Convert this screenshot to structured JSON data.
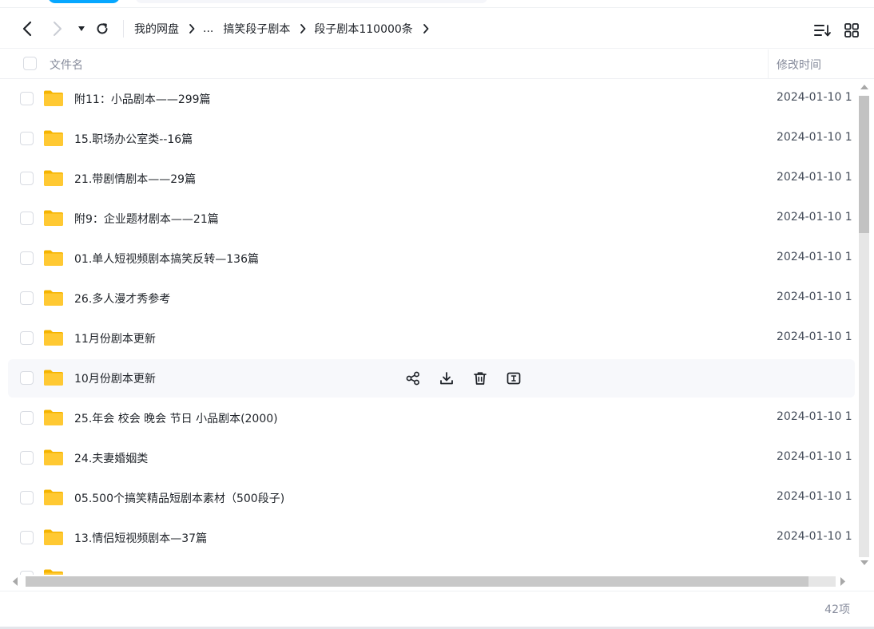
{
  "toolbar": {
    "breadcrumb": [
      {
        "label": "我的网盘"
      },
      {
        "label": "..."
      },
      {
        "label": "搞笑段子剧本"
      },
      {
        "label": "段子剧本110000条"
      }
    ]
  },
  "header": {
    "col_name": "文件名",
    "col_time": "修改时间"
  },
  "files": [
    {
      "name": "附11：小品剧本——299篇",
      "time": "2024-01-10 1"
    },
    {
      "name": "15.职场办公室类--16篇",
      "time": "2024-01-10 1"
    },
    {
      "name": "21.带剧情剧本——29篇",
      "time": "2024-01-10 1"
    },
    {
      "name": "附9：企业题材剧本——21篇",
      "time": "2024-01-10 1"
    },
    {
      "name": "01.单人短视频剧本搞笑反转—136篇",
      "time": "2024-01-10 1"
    },
    {
      "name": "26.多人漫才秀参考",
      "time": "2024-01-10 1"
    },
    {
      "name": "11月份剧本更新",
      "time": "2024-01-10 1"
    },
    {
      "name": "10月份剧本更新",
      "time": ""
    },
    {
      "name": "25.年会 校会 晚会 节日 小品剧本(2000)",
      "time": "2024-01-10 1"
    },
    {
      "name": "24.夫妻婚姻类",
      "time": "2024-01-10 1"
    },
    {
      "name": "05.500个搞笑精品短剧本素材（500段子)",
      "time": "2024-01-10 1"
    },
    {
      "name": "13.情侣短视频剧本—37篇",
      "time": "2024-01-10 1"
    }
  ],
  "hovered_row": 7,
  "footer": {
    "count": "42项"
  },
  "colors": {
    "folder": "#ffc933",
    "folder_dark": "#f5b400",
    "accent": "#06a7ff",
    "hover_bg": "#f7f8fb"
  }
}
